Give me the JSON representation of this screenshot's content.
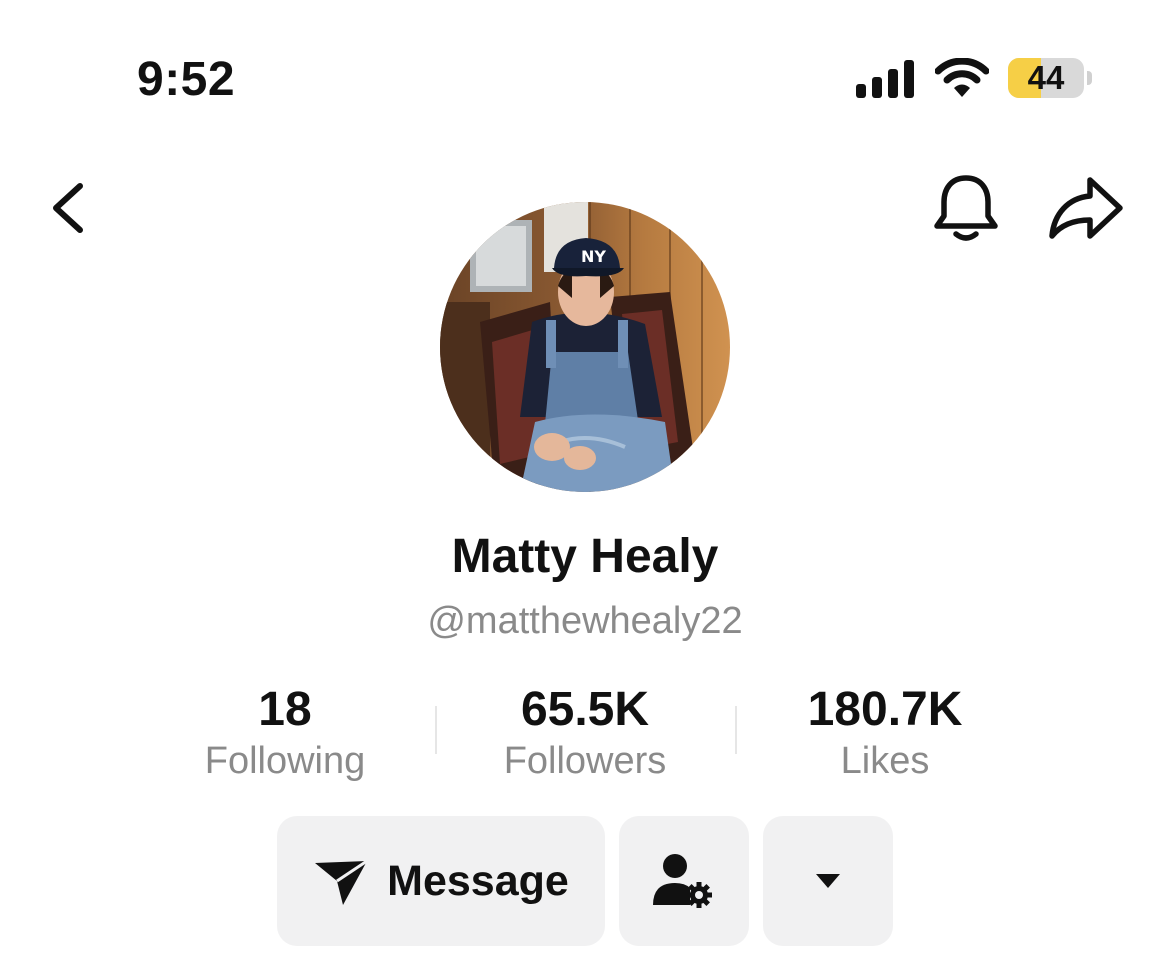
{
  "status_bar": {
    "time": "9:52",
    "signal_icon": "cellular-signal-icon",
    "wifi_icon": "wifi-icon",
    "battery_level": "44",
    "battery_fraction": 0.44,
    "battery_color": "#f6cf46"
  },
  "header": {
    "back_icon": "chevron-left-icon",
    "notifications_icon": "bell-icon",
    "share_icon": "share-arrow-icon"
  },
  "profile": {
    "avatar_description_icon": "profile-photo",
    "name": "Matty Healy",
    "handle": "@matthewhealy22"
  },
  "stats": [
    {
      "value": "18",
      "label": "Following"
    },
    {
      "value": "65.5K",
      "label": "Followers"
    },
    {
      "value": "180.7K",
      "label": "Likes"
    }
  ],
  "actions": {
    "message_label": "Message",
    "message_icon": "send-arrow-icon",
    "friend_icon": "person-gear-icon",
    "more_icon": "caret-down-icon"
  },
  "colors": {
    "text_primary": "#111111",
    "text_secondary": "#8a8a8a",
    "button_bg": "#f1f1f2"
  }
}
